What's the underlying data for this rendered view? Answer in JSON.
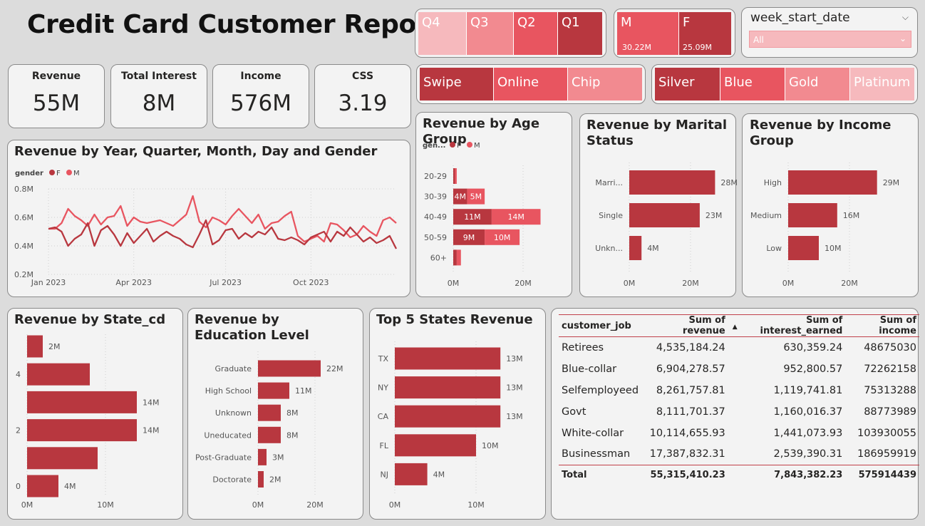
{
  "title": "Credit Card Customer Report",
  "colors": {
    "dark_red": "#b8373f",
    "red": "#e85560",
    "light_red": "#f28a90",
    "pale_red": "#f6b9bd"
  },
  "kpis": [
    {
      "label": "Revenue",
      "value": "55M"
    },
    {
      "label": "Total Interest",
      "value": "8M"
    },
    {
      "label": "Income",
      "value": "576M"
    },
    {
      "label": "CSS",
      "value": "3.19"
    }
  ],
  "slicers": {
    "quarter": [
      "Q4",
      "Q3",
      "Q2",
      "Q1"
    ],
    "gender": [
      {
        "label": "M",
        "value": "30.22M"
      },
      {
        "label": "F",
        "value": "25.09M"
      }
    ],
    "week": {
      "label": "week_start_date",
      "value": "All"
    },
    "card_use": [
      "Swipe",
      "Online",
      "Chip"
    ],
    "card_category": [
      "Silver",
      "Blue",
      "Gold",
      "Platinum"
    ]
  },
  "charts": {
    "line": {
      "type": "line",
      "title": "Revenue by Year, Quarter, Month, Day and Gender",
      "legend_title": "gender",
      "legend": [
        "F",
        "M"
      ],
      "y_ticks": [
        "0.8M",
        "0.6M",
        "0.4M",
        "0.2M"
      ],
      "x_ticks": [
        "Jan 2023",
        "Apr 2023",
        "Jul 2023",
        "Oct 2023"
      ],
      "ylim": [
        0.2,
        0.8
      ],
      "series": [
        {
          "name": "F",
          "values": [
            0.52,
            0.53,
            0.5,
            0.4,
            0.45,
            0.48,
            0.56,
            0.4,
            0.51,
            0.54,
            0.48,
            0.4,
            0.49,
            0.42,
            0.47,
            0.52,
            0.43,
            0.47,
            0.5,
            0.47,
            0.45,
            0.41,
            0.39,
            0.48,
            0.58,
            0.41,
            0.44,
            0.51,
            0.52,
            0.45,
            0.49,
            0.46,
            0.5,
            0.48,
            0.53,
            0.45,
            0.44,
            0.46,
            0.44,
            0.41,
            0.46,
            0.48,
            0.5,
            0.43,
            0.5,
            0.47,
            0.53,
            0.48,
            0.43,
            0.46,
            0.42,
            0.44,
            0.47,
            0.38
          ]
        },
        {
          "name": "M",
          "values": [
            0.52,
            0.52,
            0.56,
            0.66,
            0.61,
            0.58,
            0.54,
            0.62,
            0.55,
            0.6,
            0.61,
            0.68,
            0.54,
            0.6,
            0.57,
            0.56,
            0.57,
            0.58,
            0.56,
            0.54,
            0.58,
            0.62,
            0.75,
            0.57,
            0.53,
            0.6,
            0.58,
            0.55,
            0.61,
            0.66,
            0.61,
            0.56,
            0.62,
            0.52,
            0.56,
            0.57,
            0.61,
            0.64,
            0.47,
            0.43,
            0.45,
            0.47,
            0.43,
            0.56,
            0.55,
            0.51,
            0.46,
            0.48,
            0.54,
            0.5,
            0.47,
            0.58,
            0.6,
            0.56
          ]
        }
      ]
    },
    "age": {
      "type": "bar",
      "title": "Revenue by Age Group",
      "legend_title": "gen...",
      "legend": [
        "F",
        "M"
      ],
      "categories": [
        "20-29",
        "30-39",
        "40-49",
        "50-59",
        "60+"
      ],
      "series": [
        {
          "name": "F",
          "values": [
            0.5,
            4,
            11,
            9,
            1
          ],
          "labels": [
            "",
            "4M",
            "11M",
            "9M",
            ""
          ]
        },
        {
          "name": "M",
          "values": [
            0.5,
            5,
            14,
            10,
            1.2
          ],
          "labels": [
            "",
            "5M",
            "14M",
            "10M",
            ""
          ]
        }
      ],
      "x_ticks": [
        "0M",
        "20M"
      ],
      "xlim": [
        0,
        20
      ]
    },
    "marital": {
      "type": "bar",
      "title": "Revenue by Marital Status",
      "categories": [
        "Marri...",
        "Single",
        "Unkn..."
      ],
      "values": [
        28,
        23,
        4
      ],
      "labels": [
        "28M",
        "23M",
        "4M"
      ],
      "x_ticks": [
        "0M",
        "20M"
      ],
      "xlim": [
        0,
        20
      ]
    },
    "income": {
      "type": "bar",
      "title": "Revenue by Income Group",
      "categories": [
        "High",
        "Medium",
        "Low"
      ],
      "values": [
        29,
        16,
        10
      ],
      "labels": [
        "29M",
        "16M",
        "10M"
      ],
      "x_ticks": [
        "0M",
        "20M"
      ],
      "xlim": [
        0,
        20
      ]
    },
    "state": {
      "type": "bar",
      "title": "Revenue by State_cd",
      "categories": [
        "",
        "4",
        "",
        "2",
        "",
        "0"
      ],
      "values": [
        2,
        8,
        14,
        14,
        9,
        4
      ],
      "labels": [
        "2M",
        "",
        "14M",
        "14M",
        "",
        "4M"
      ],
      "x_ticks": [
        "0M",
        "10M"
      ],
      "xlim": [
        0,
        10
      ]
    },
    "education": {
      "type": "bar",
      "title": "Revenue by Education Level",
      "categories": [
        "Graduate",
        "High School",
        "Unknown",
        "Uneducated",
        "Post-Graduate",
        "Doctorate"
      ],
      "values": [
        22,
        11,
        8,
        8,
        3,
        2
      ],
      "labels": [
        "22M",
        "11M",
        "8M",
        "8M",
        "3M",
        "2M"
      ],
      "x_ticks": [
        "0M",
        "20M"
      ],
      "xlim": [
        0,
        20
      ]
    },
    "top5": {
      "type": "bar",
      "title": "Top 5 States Revenue",
      "categories": [
        "TX",
        "NY",
        "CA",
        "FL",
        "NJ"
      ],
      "values": [
        13,
        13,
        13,
        10,
        4
      ],
      "labels": [
        "13M",
        "13M",
        "13M",
        "10M",
        "4M"
      ],
      "x_ticks": [
        "0M",
        "10M"
      ],
      "xlim": [
        0,
        10
      ]
    }
  },
  "table": {
    "columns": [
      "customer_job",
      "Sum of revenue",
      "Sum of interest_earned",
      "Sum of income"
    ],
    "sort_icon": "▲",
    "rows": [
      [
        "Retirees",
        "4,535,184.24",
        "630,359.24",
        "48675030"
      ],
      [
        "Blue-collar",
        "6,904,278.57",
        "952,800.57",
        "72262158"
      ],
      [
        "Selfemployeed",
        "8,261,757.81",
        "1,119,741.81",
        "75313288"
      ],
      [
        "Govt",
        "8,111,701.37",
        "1,160,016.37",
        "88773989"
      ],
      [
        "White-collar",
        "10,114,655.93",
        "1,441,073.93",
        "103930055"
      ],
      [
        "Businessman",
        "17,387,832.31",
        "2,539,390.31",
        "186959919"
      ]
    ],
    "total": [
      "Total",
      "55,315,410.23",
      "7,843,382.23",
      "575914439"
    ]
  }
}
